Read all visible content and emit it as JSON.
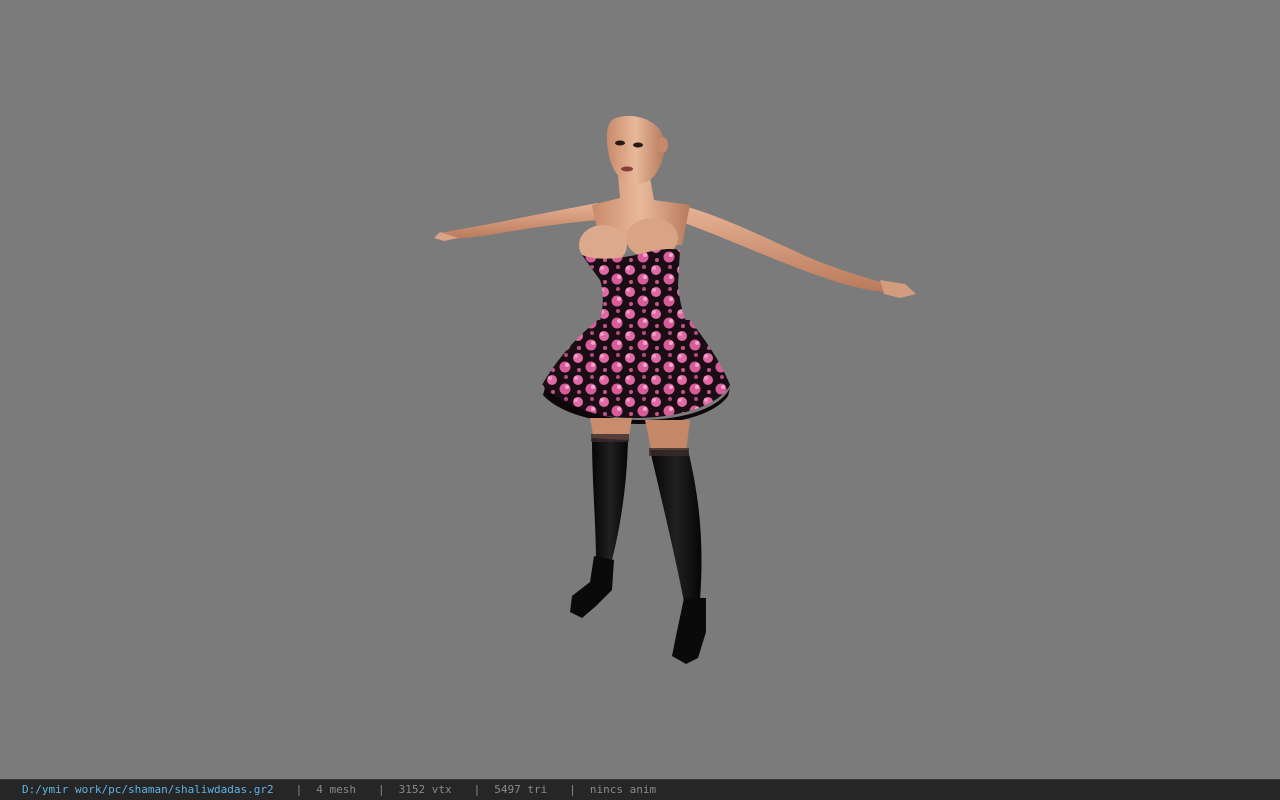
{
  "viewport": {
    "background": "#7b7b7b",
    "model_description": "3D character model in T-pose wearing pink floral dress and black stockings"
  },
  "statusbar": {
    "file_path": "D:/ymir work/pc/shaman/shaliwdadas.gr2",
    "separator": "|",
    "mesh_count": "4 mesh",
    "vertex_count": "3152 vtx",
    "triangle_count": "5497 tri",
    "anim_status": "nincs anim",
    "path_color": "#5fb3e6",
    "text_color": "#8a8a8a"
  }
}
